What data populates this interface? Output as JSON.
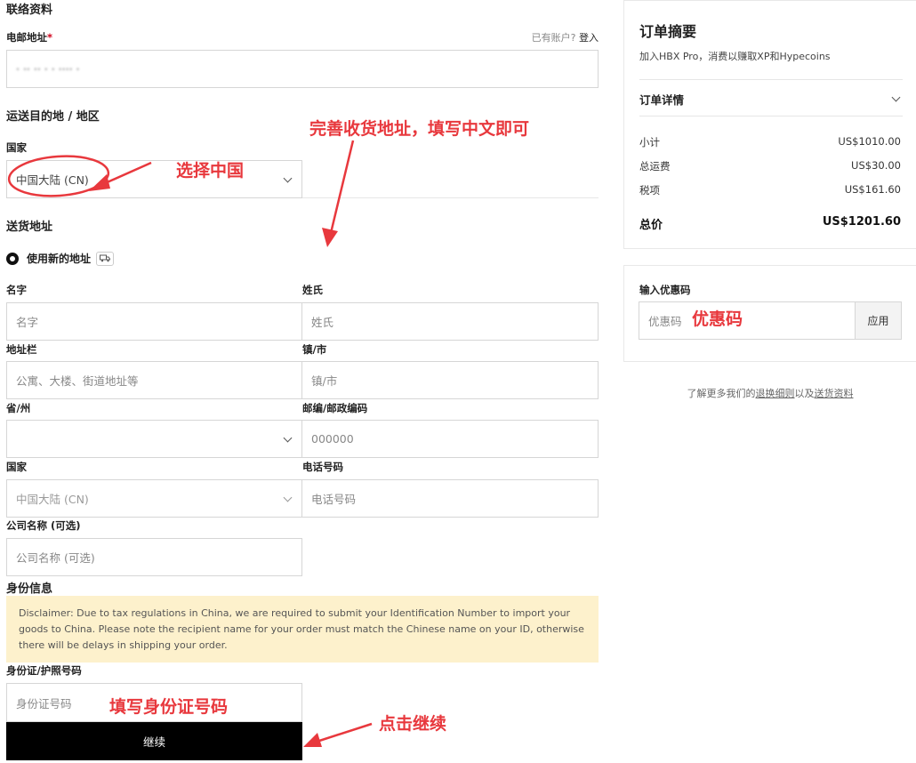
{
  "contact": {
    "heading": "联络资料",
    "email_label": "电邮地址",
    "required_star": "*",
    "account_prompt": "已有账户?",
    "login_link": "登入",
    "email_value": "· ·· ·· · · ···· ·"
  },
  "shipping_region": {
    "heading": "运送目的地 / 地区",
    "country_label": "国家",
    "country_value": "中国大陆 (CN)"
  },
  "address": {
    "heading": "送货地址",
    "use_new_address": "使用新的地址",
    "first_name_label": "名字",
    "first_name_placeholder": "名字",
    "last_name_label": "姓氏",
    "last_name_placeholder": "姓氏",
    "street_label": "地址栏",
    "street_placeholder": "公寓、大楼、街道地址等",
    "city_label": "镇/市",
    "city_placeholder": "镇/市",
    "province_label": "省/州",
    "province_value": "",
    "postcode_label": "邮编/邮政编码",
    "postcode_placeholder": "000000",
    "country_label": "国家",
    "country_value": "中国大陆 (CN)",
    "phone_label": "电话号码",
    "phone_placeholder": "电话号码",
    "company_label": "公司名称 (可选)",
    "company_placeholder": "公司名称 (可选)"
  },
  "identity": {
    "heading": "身份信息",
    "disclaimer": "Disclaimer: Due to tax regulations in China, we are required to submit your Identification Number to import your goods to China. Please note the recipient name for your order must match the Chinese name on your ID, otherwise there will be delays in shipping your order.",
    "id_label": "身份证/护照号码",
    "id_placeholder": "身份证号码",
    "continue_button": "继续"
  },
  "summary": {
    "title": "订单摘要",
    "promo": "加入HBX Pro，消费以赚取XP和Hypecoins",
    "details_label": "订单详情",
    "subtotal_label": "小计",
    "subtotal_value": "US$1010.00",
    "shipping_label": "总运费",
    "shipping_value": "US$30.00",
    "tax_label": "税项",
    "tax_value": "US$161.60",
    "total_label": "总价",
    "total_value": "US$1201.60"
  },
  "coupon": {
    "label": "输入优惠码",
    "placeholder": "优惠码",
    "apply_button": "应用"
  },
  "footer_links": {
    "prefix": "了解更多我们的",
    "returns": "退换细则",
    "middle": "以及",
    "shipping": "送货资料"
  },
  "annotations": {
    "complete_address": "完善收货地址，填写中文即可",
    "select_china": "选择中国",
    "coupon_code": "优惠码",
    "fill_id": "填写身份证号码",
    "click_continue": "点击继续"
  },
  "colors": {
    "annotation_red": "#e8383d",
    "disclaimer_bg": "#fdf1cc",
    "button_bg": "#000000"
  }
}
